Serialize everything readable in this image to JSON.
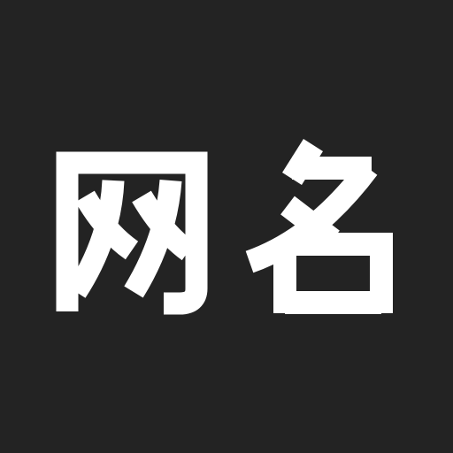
{
  "logo": {
    "text": "网名",
    "glyphs": [
      "网",
      "名"
    ],
    "background_color": "#232323",
    "foreground_color": "#FFFFFF"
  }
}
